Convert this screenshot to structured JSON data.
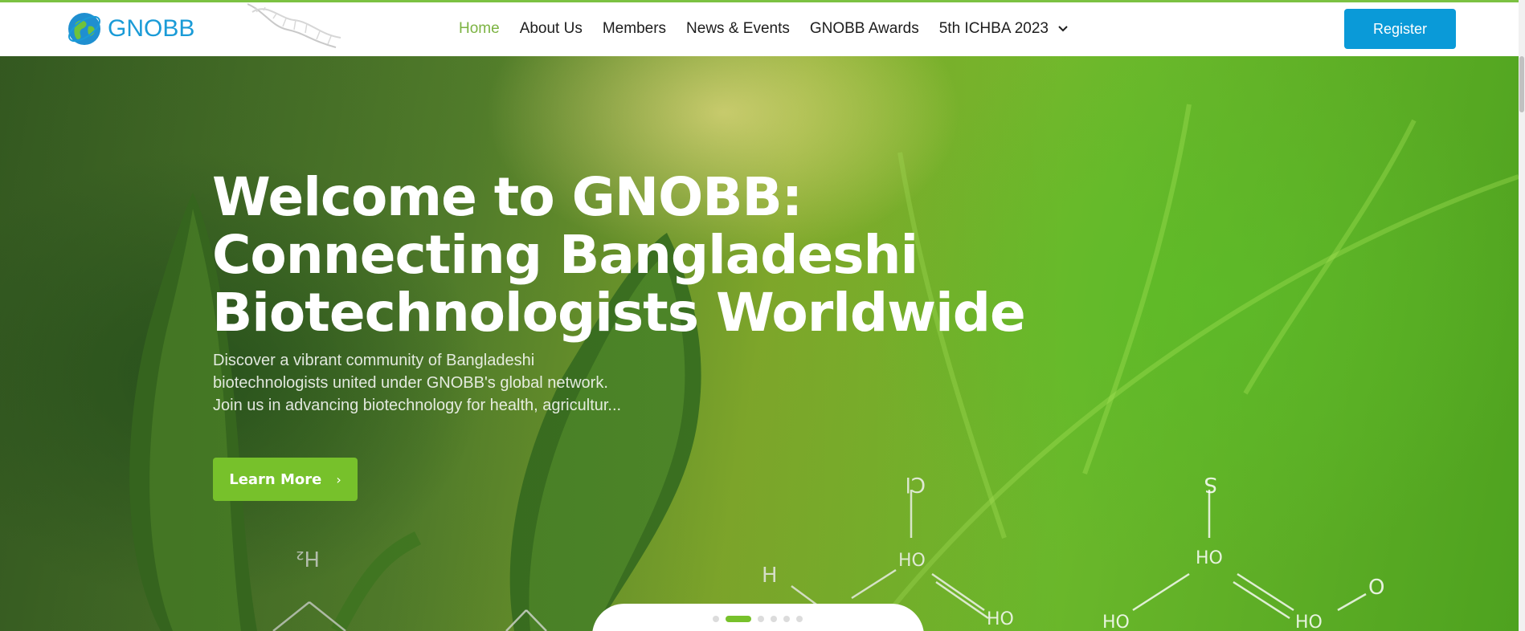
{
  "header": {
    "brand": "GNOBB",
    "nav": [
      {
        "label": "Home",
        "active": true
      },
      {
        "label": "About Us",
        "active": false
      },
      {
        "label": "Members",
        "active": false
      },
      {
        "label": "News & Events",
        "active": false
      },
      {
        "label": "GNOBB Awards",
        "active": false
      },
      {
        "label": "5th ICHBA 2023",
        "active": false,
        "dropdown": true
      }
    ],
    "register_label": "Register"
  },
  "hero": {
    "title_line1": "Welcome to GNOBB:",
    "title_line2": "Connecting Bangladeshi",
    "title_line3": "Biotechnologists Worldwide",
    "desc_line1": "Discover a vibrant community of Bangladeshi",
    "desc_line2": "biotechnologists united under GNOBB's global network.",
    "desc_line3": "Join us in advancing biotechnology for health, agricultur...",
    "cta_label": "Learn More",
    "cta_icon": "chevron-right-icon"
  },
  "slider": {
    "slide_count": 6,
    "active_index": 1
  },
  "colors": {
    "accent_green": "#77c12b",
    "nav_active": "#7cb342",
    "register_blue": "#0a9ad8",
    "brand_blue": "#1a9bd7"
  }
}
